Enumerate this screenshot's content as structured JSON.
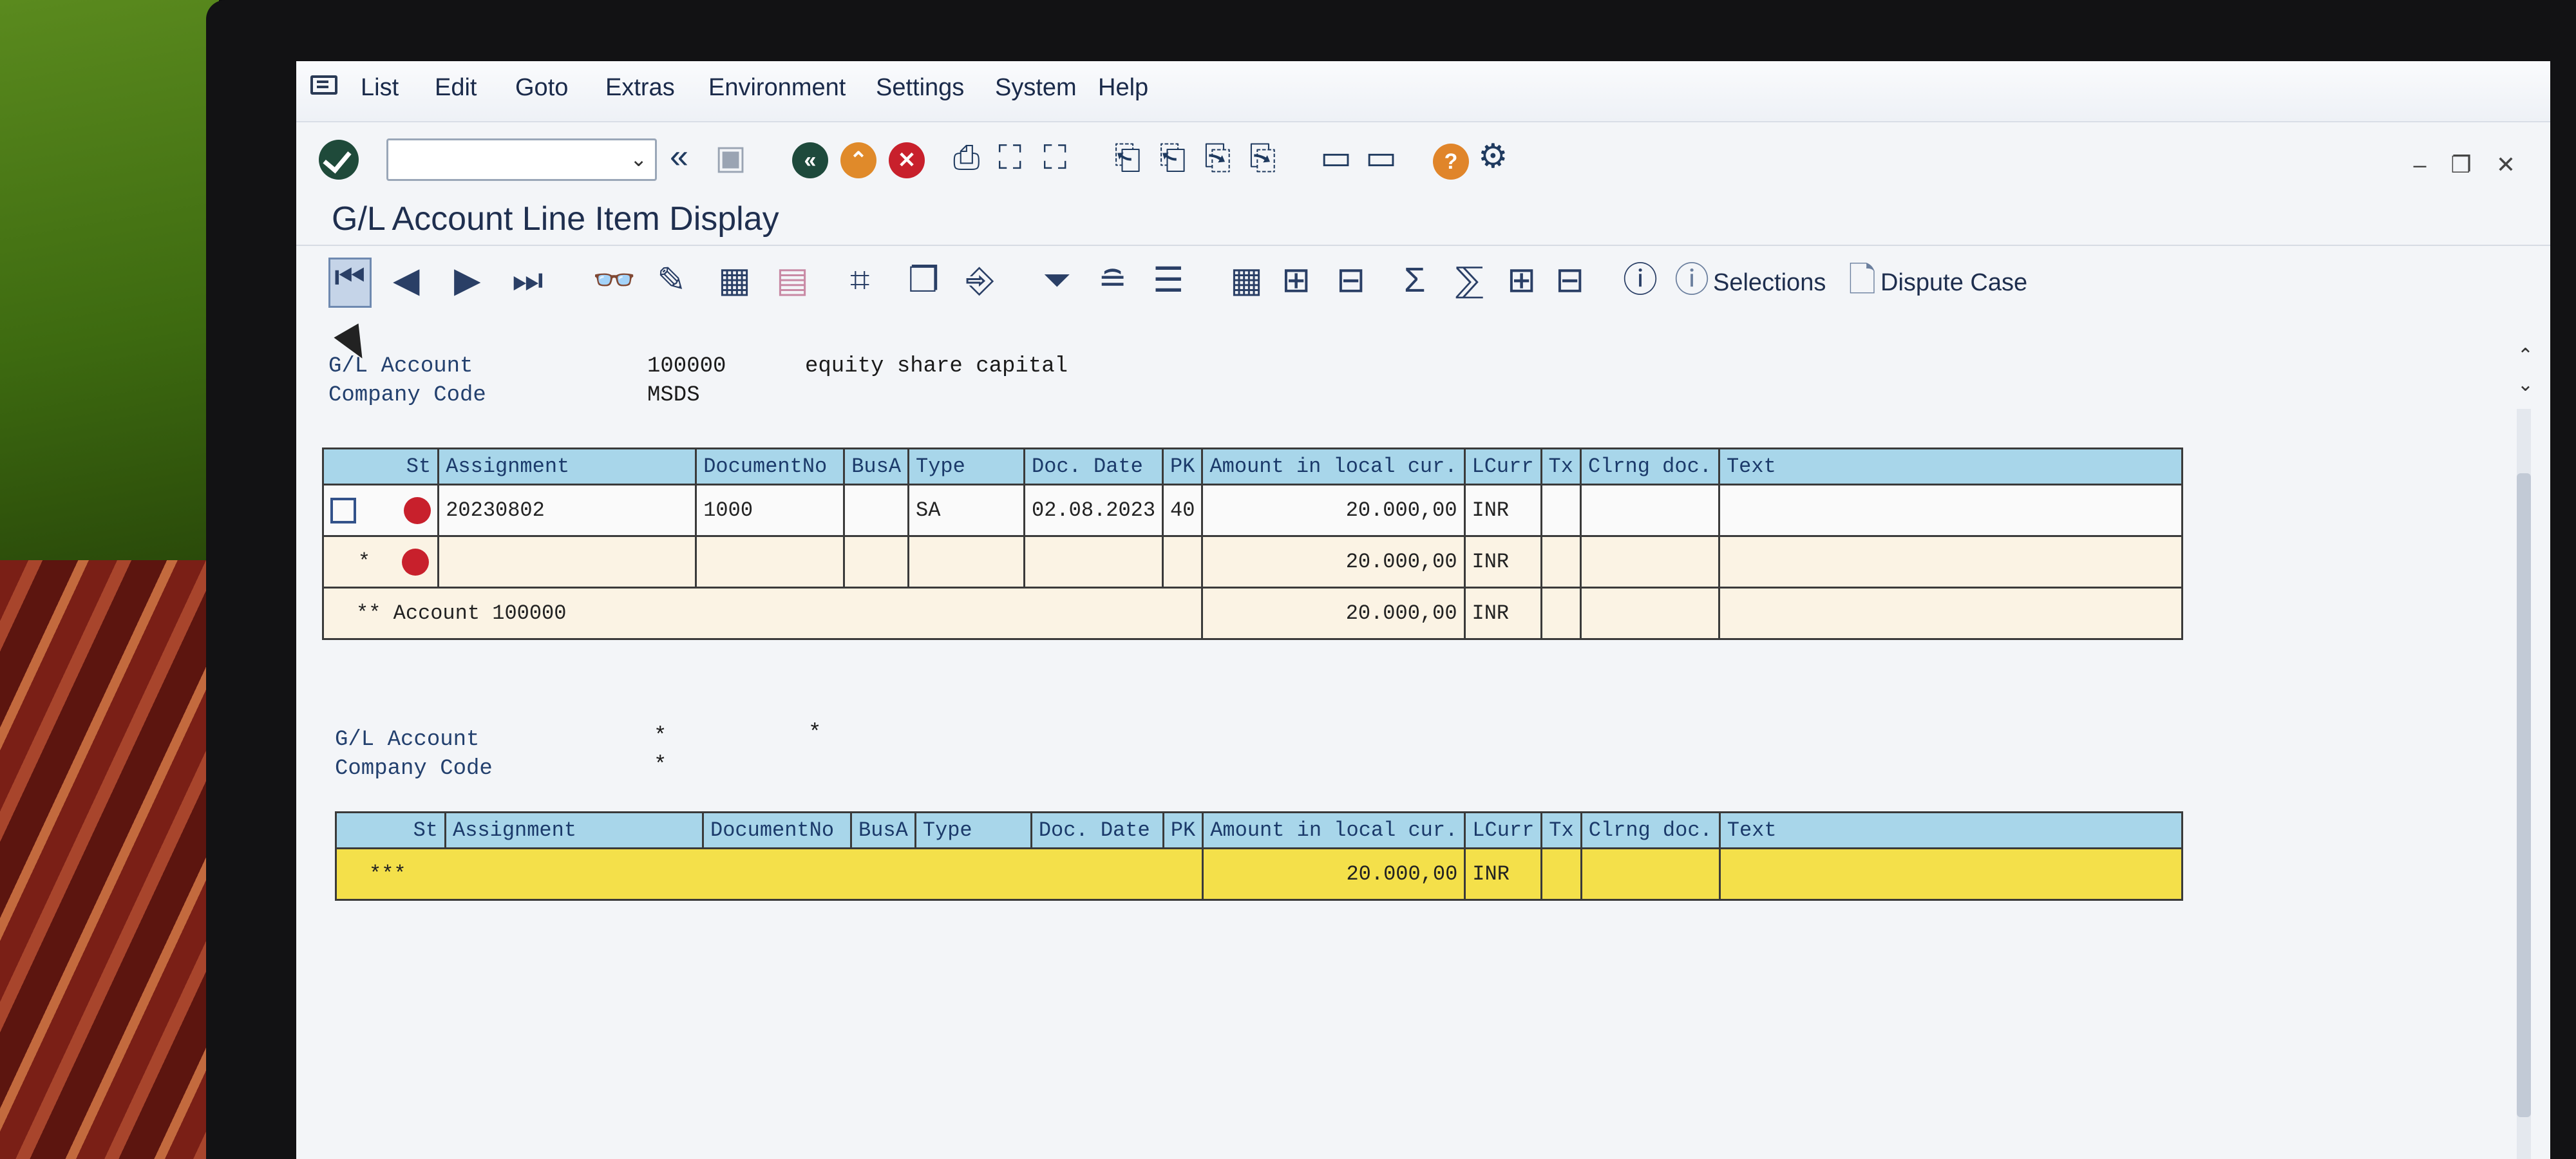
{
  "menu": [
    "List",
    "Edit",
    "Goto",
    "Extras",
    "Environment",
    "Settings",
    "System",
    "Help"
  ],
  "title": "G/L Account Line Item Display",
  "toolbar2": {
    "selections_label": "Selections",
    "dispute_label": "Dispute Case"
  },
  "section1": {
    "gl_account_label": "G/L Account",
    "gl_account_value": "100000",
    "gl_account_desc": "equity share capital",
    "company_code_label": "Company Code",
    "company_code_value": "MSDS"
  },
  "columns": [
    "St",
    "Assignment",
    "DocumentNo",
    "BusA",
    "Type",
    "Doc. Date",
    "PK",
    "Amount in local cur.",
    "LCurr",
    "Tx",
    "Clrng doc.",
    "Text"
  ],
  "rows": [
    {
      "st": "red",
      "assignment": "20230802",
      "document_no": "1000",
      "busa": "",
      "type": "SA",
      "doc_date": "02.08.2023",
      "pk": "40",
      "amount": "20.000,00",
      "lcurr": "INR",
      "tx": "",
      "clrng_doc": "",
      "text": ""
    }
  ],
  "subtotal": {
    "marker": "*",
    "amount": "20.000,00",
    "lcurr": "INR"
  },
  "account_total": {
    "label": "** Account 100000",
    "amount": "20.000,00",
    "lcurr": "INR"
  },
  "section2": {
    "gl_account_label": "G/L Account",
    "gl_account_value": "*",
    "gl_account_desc": "*",
    "company_code_label": "Company Code",
    "company_code_value": "*"
  },
  "grand_total": {
    "marker": "***",
    "amount": "20.000,00",
    "lcurr": "INR"
  },
  "colors": {
    "header_bg": "#a8d6ea",
    "grand_total_bg": "#f4e04a",
    "status_red": "#c8202c"
  }
}
